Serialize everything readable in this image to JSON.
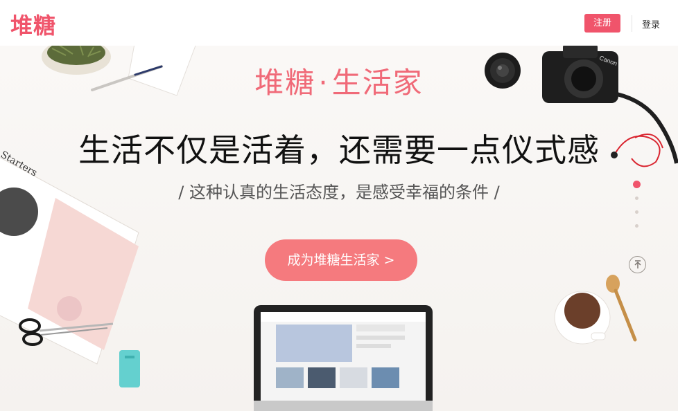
{
  "header": {
    "logo_text": "堆糖",
    "register_label": "注册",
    "login_label": "登录"
  },
  "hero": {
    "brand_left": "堆糖",
    "brand_sep": "·",
    "brand_right": "生活家",
    "headline": "生活不仅是活着，还需要一点仪式感",
    "subline": "/ 这种认真的生活态度，是感受幸福的条件 /",
    "cta_label": "成为堆糖生活家 >"
  },
  "pagination": {
    "count": 4,
    "active_index": 0
  },
  "book": {
    "cover_text": "Starters"
  },
  "camera": {
    "brand": "Canon"
  },
  "colors": {
    "brand": "#f0546b",
    "cta": "#f57a7e",
    "brand_title": "#f06a78"
  },
  "icons": {
    "back_to_top": "back-to-top-icon"
  }
}
